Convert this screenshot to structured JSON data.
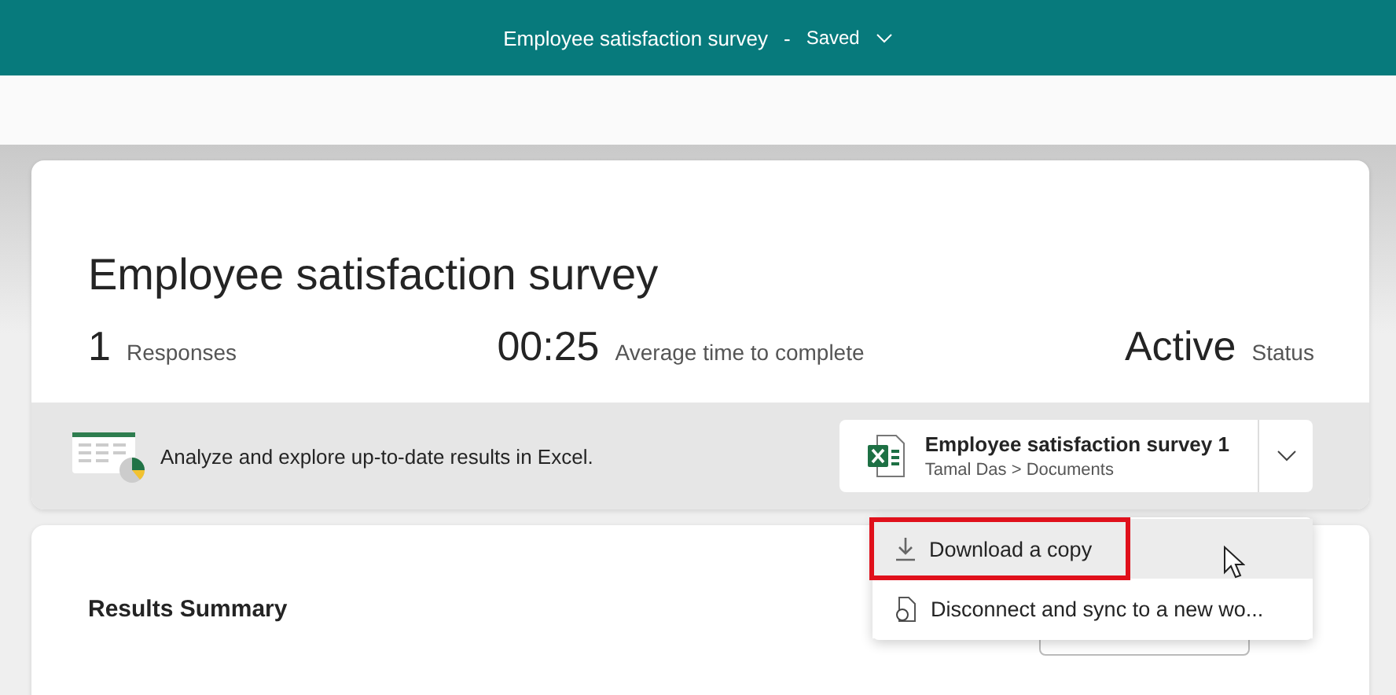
{
  "top_bar": {
    "title": "Employee satisfaction survey",
    "separator": "-",
    "status": "Saved"
  },
  "summary": {
    "title": "Employee satisfaction survey",
    "stats": [
      {
        "value": "1",
        "label": "Responses"
      },
      {
        "value": "00:25",
        "label": "Average time to complete"
      },
      {
        "value": "Active",
        "label": "Status"
      }
    ]
  },
  "excel_bar": {
    "text": "Analyze and explore up-to-date results in Excel.",
    "file": {
      "name": "Employee satisfaction survey 1",
      "path": "Tamal Das > Documents"
    }
  },
  "menu": {
    "items": [
      {
        "kind": "download",
        "label": "Download a copy",
        "selected": true,
        "annotated": true
      },
      {
        "kind": "disconnect",
        "label": "Disconnect and sync to a new wo...",
        "selected": false,
        "annotated": false
      }
    ]
  },
  "results": {
    "title": "Results Summary"
  }
}
